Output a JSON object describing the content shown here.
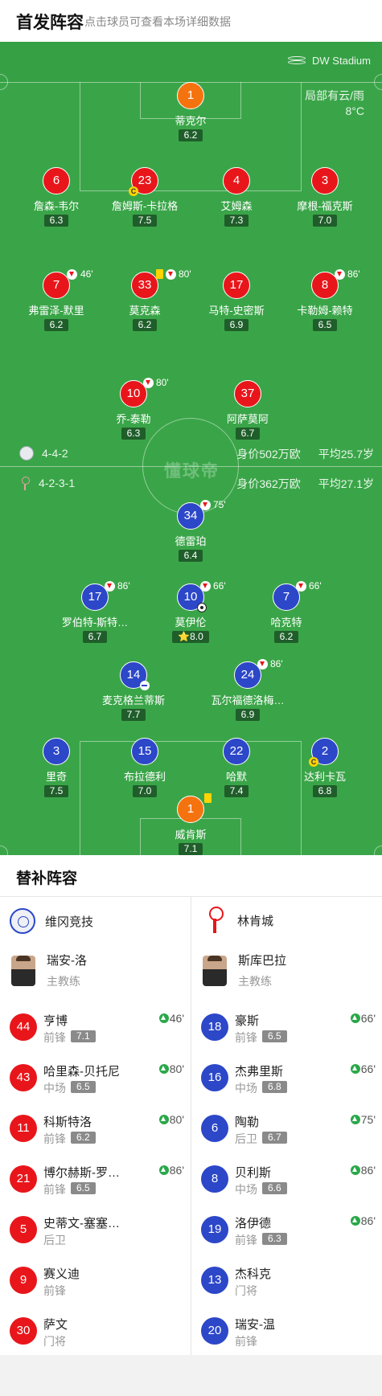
{
  "header": {
    "title": "首发阵容",
    "hint": "点击球员可查看本场详细数据"
  },
  "pitch": {
    "stadium": "DW Stadium",
    "weather_line1": "局部有云/雨",
    "weather_line2": "8°C",
    "watermark": "懂球帝",
    "home_formation": "4-4-2",
    "home_value": "身价502万欧",
    "home_age": "平均25.7岁",
    "away_formation": "4-2-3-1",
    "away_value": "身价362万欧",
    "away_age": "平均27.1岁"
  },
  "home_players": [
    {
      "num": "1",
      "name": "蒂克尔",
      "rating": "6.2"
    },
    {
      "num": "6",
      "name": "詹森-韦尔",
      "rating": "6.3"
    },
    {
      "num": "23",
      "name": "詹姆斯-卡拉格",
      "rating": "7.5",
      "captain": "C"
    },
    {
      "num": "4",
      "name": "艾姆森",
      "rating": "7.3"
    },
    {
      "num": "3",
      "name": "摩根-福克斯",
      "rating": "7.0"
    },
    {
      "num": "7",
      "name": "弗雷泽-默里",
      "rating": "6.2",
      "sub_out": "46'"
    },
    {
      "num": "33",
      "name": "莫克森",
      "rating": "6.2",
      "sub_out": "80'"
    },
    {
      "num": "17",
      "name": "马特-史密斯",
      "rating": "6.9"
    },
    {
      "num": "8",
      "name": "卡勒姆-赖特",
      "rating": "6.5",
      "sub_out": "86'"
    },
    {
      "num": "10",
      "name": "乔-泰勒",
      "rating": "6.3",
      "sub_out": "80'"
    },
    {
      "num": "37",
      "name": "阿萨莫阿",
      "rating": "6.7"
    }
  ],
  "away_players": [
    {
      "num": "34",
      "name": "德雷珀",
      "rating": "6.4",
      "sub_out": "75'"
    },
    {
      "num": "17",
      "name": "罗伯特-斯特…",
      "rating": "6.7",
      "sub_out": "86'"
    },
    {
      "num": "10",
      "name": "莫伊伦",
      "rating": "8.0",
      "sub_out": "66'",
      "star": "⭐"
    },
    {
      "num": "7",
      "name": "哈克特",
      "rating": "6.2",
      "sub_out": "66'"
    },
    {
      "num": "14",
      "name": "麦克格兰蒂斯",
      "rating": "7.7"
    },
    {
      "num": "24",
      "name": "瓦尔福德洛梅…",
      "rating": "6.9",
      "sub_out": "86'"
    },
    {
      "num": "3",
      "name": "里奇",
      "rating": "7.5"
    },
    {
      "num": "15",
      "name": "布拉德利",
      "rating": "7.0"
    },
    {
      "num": "22",
      "name": "哈默",
      "rating": "7.4"
    },
    {
      "num": "2",
      "name": "达利卡瓦",
      "rating": "6.8",
      "captain": "C"
    },
    {
      "num": "1",
      "name": "威肯斯",
      "rating": "7.1"
    }
  ],
  "subs": {
    "title": "替补阵容",
    "home_team": "维冈竞技",
    "away_team": "林肯城",
    "home_coach": {
      "name": "瑞安-洛",
      "role": "主教练"
    },
    "away_coach": {
      "name": "斯库巴拉",
      "role": "主教练"
    },
    "home": [
      {
        "num": "44",
        "name": "亨博",
        "pos": "前锋",
        "rating": "7.1",
        "in": "46'"
      },
      {
        "num": "43",
        "name": "哈里森-贝托尼",
        "pos": "中场",
        "rating": "6.5",
        "in": "80'"
      },
      {
        "num": "11",
        "name": "科斯特洛",
        "pos": "前锋",
        "rating": "6.2",
        "in": "80'"
      },
      {
        "num": "21",
        "name": "博尔赫斯-罗…",
        "pos": "前锋",
        "rating": "6.5",
        "in": "86'"
      },
      {
        "num": "5",
        "name": "史蒂文-塞塞…",
        "pos": "后卫"
      },
      {
        "num": "9",
        "name": "赛义迪",
        "pos": "前锋"
      },
      {
        "num": "30",
        "name": "萨文",
        "pos": "门将"
      }
    ],
    "away": [
      {
        "num": "18",
        "name": "豪斯",
        "pos": "前锋",
        "rating": "6.5",
        "in": "66'"
      },
      {
        "num": "16",
        "name": "杰弗里斯",
        "pos": "中场",
        "rating": "6.8",
        "in": "66'"
      },
      {
        "num": "6",
        "name": "陶勒",
        "pos": "后卫",
        "rating": "6.7",
        "in": "75'"
      },
      {
        "num": "8",
        "name": "贝利斯",
        "pos": "中场",
        "rating": "6.6",
        "in": "86'"
      },
      {
        "num": "19",
        "name": "洛伊德",
        "pos": "前锋",
        "rating": "6.3",
        "in": "86'"
      },
      {
        "num": "13",
        "name": "杰科克",
        "pos": "门将"
      },
      {
        "num": "20",
        "name": "瑞安-温",
        "pos": "前锋"
      }
    ]
  },
  "colors": {
    "home": "#e8161b",
    "away": "#2c47c8",
    "goalkeeper": "#f5730f",
    "pitch": "#3aa548"
  }
}
